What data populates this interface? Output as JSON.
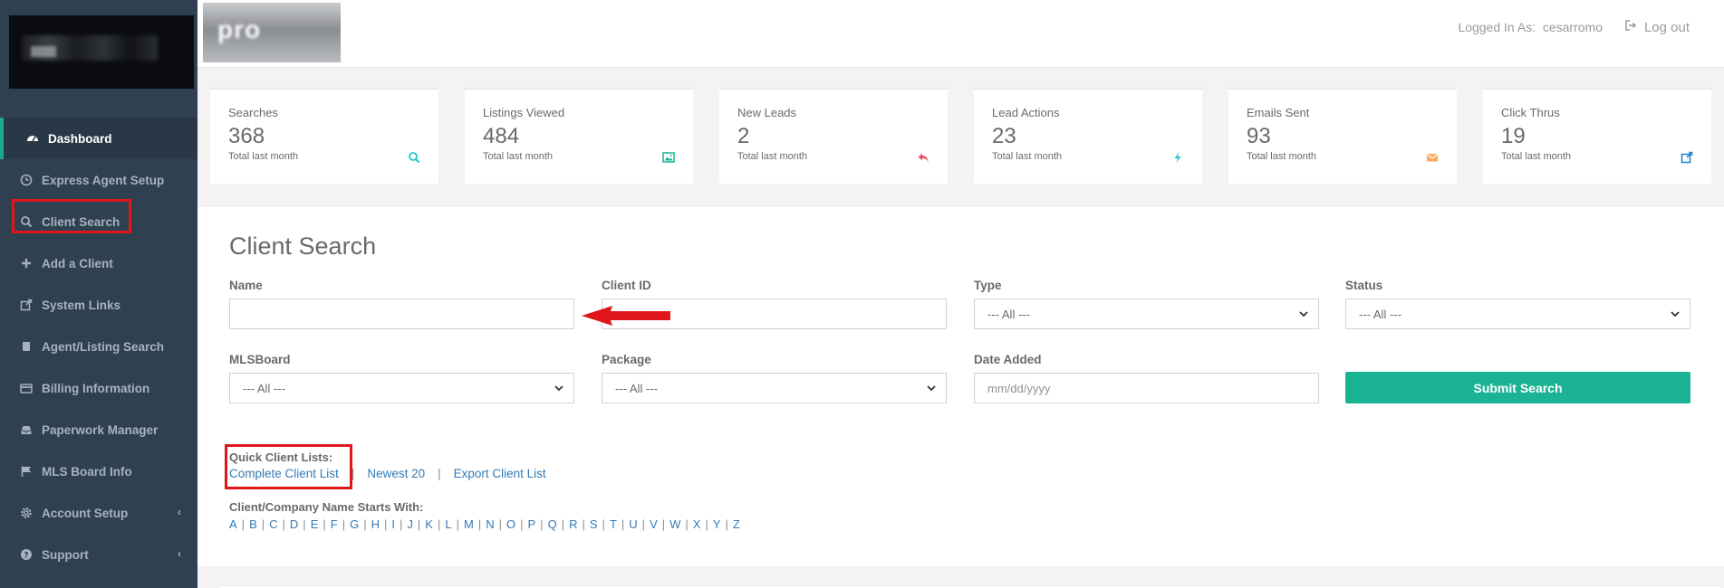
{
  "sidebar": {
    "items": [
      {
        "label": "Dashboard",
        "icon": "dashboard-icon"
      },
      {
        "label": "Express Agent Setup",
        "icon": "circle-clock-icon"
      },
      {
        "label": "Client Search",
        "icon": "search-icon"
      },
      {
        "label": "Add a Client",
        "icon": "plus-icon"
      },
      {
        "label": "System Links",
        "icon": "external-link-icon"
      },
      {
        "label": "Agent/Listing Search",
        "icon": "book-icon"
      },
      {
        "label": "Billing Information",
        "icon": "credit-card-icon"
      },
      {
        "label": "Paperwork Manager",
        "icon": "inbox-icon"
      },
      {
        "label": "MLS Board Info",
        "icon": "flag-icon"
      },
      {
        "label": "Account Setup",
        "icon": "gear-icon"
      },
      {
        "label": "Support",
        "icon": "question-circle-icon"
      }
    ],
    "expand_arrow": "‹"
  },
  "topbar": {
    "brand_text": "pro",
    "logged_in_label": "Logged In As:",
    "username": "cesarromo",
    "logout_label": "Log out"
  },
  "stats": [
    {
      "label": "Searches",
      "value": "368",
      "sub": "Total last month",
      "icon": "search-icon",
      "color": "#23c6c8"
    },
    {
      "label": "Listings Viewed",
      "value": "484",
      "sub": "Total last month",
      "icon": "image-icon",
      "color": "#1ab394"
    },
    {
      "label": "New Leads",
      "value": "2",
      "sub": "Total last month",
      "icon": "reply-icon",
      "color": "#ed5565"
    },
    {
      "label": "Lead Actions",
      "value": "23",
      "sub": "Total last month",
      "icon": "bolt-icon",
      "color": "#23c6c8"
    },
    {
      "label": "Emails Sent",
      "value": "93",
      "sub": "Total last month",
      "icon": "envelope-icon",
      "color": "#f8ac59"
    },
    {
      "label": "Click Thrus",
      "value": "19",
      "sub": "Total last month",
      "icon": "external-link-icon",
      "color": "#1c84c6"
    }
  ],
  "search": {
    "title": "Client Search",
    "name_label": "Name",
    "name_value": "",
    "client_id_label": "Client ID",
    "client_id_value": "",
    "type_label": "Type",
    "type_value": "--- All ---",
    "status_label": "Status",
    "status_value": "--- All ---",
    "mlsboard_label": "MLSBoard",
    "mlsboard_value": "--- All ---",
    "package_label": "Package",
    "package_value": "--- All ---",
    "date_label": "Date Added",
    "date_placeholder": "mm/dd/yyyy",
    "submit_label": "Submit Search"
  },
  "quick_lists": {
    "title": "Quick Client Lists:",
    "links": [
      "Complete Client List",
      "Newest 20",
      "Export Client List"
    ],
    "separator": "|"
  },
  "starts_with": {
    "title": "Client/Company Name Starts With:",
    "letters": [
      "A",
      "B",
      "C",
      "D",
      "E",
      "F",
      "G",
      "H",
      "I",
      "J",
      "K",
      "L",
      "M",
      "N",
      "O",
      "P",
      "Q",
      "R",
      "S",
      "T",
      "U",
      "V",
      "W",
      "X",
      "Y",
      "Z"
    ]
  },
  "colors": {
    "sidebar_bg": "#2f4050",
    "accent": "#1ab394",
    "link": "#337ab7",
    "annotation_red": "#e0161b"
  }
}
